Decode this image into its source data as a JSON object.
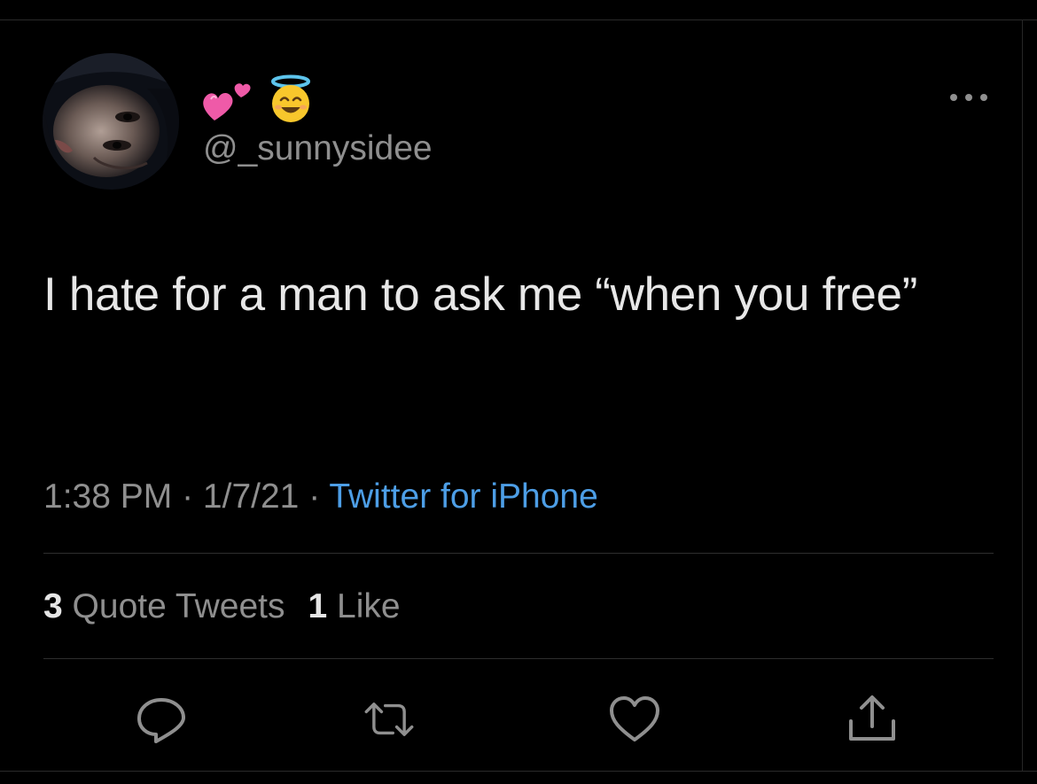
{
  "author": {
    "display_name": "💕😇",
    "handle": "@_sunnysidee",
    "avatar": "profile-photo"
  },
  "tweet": {
    "text": "I hate for a man to ask me “when you free”",
    "time": "1:38 PM",
    "separator": " · ",
    "date": "1/7/21",
    "source": "Twitter for iPhone"
  },
  "stats": {
    "quote_count": "3",
    "quote_label": "Quote Tweets",
    "like_count": "1",
    "like_label": "Like"
  },
  "actions": [
    {
      "icon": "reply-icon"
    },
    {
      "icon": "retweet-icon"
    },
    {
      "icon": "heart-icon"
    },
    {
      "icon": "share-icon"
    }
  ],
  "colors": {
    "background": "#000000",
    "text": "#e7e7e7",
    "secondary": "#8f8f8f",
    "link": "#4d9ee6"
  }
}
